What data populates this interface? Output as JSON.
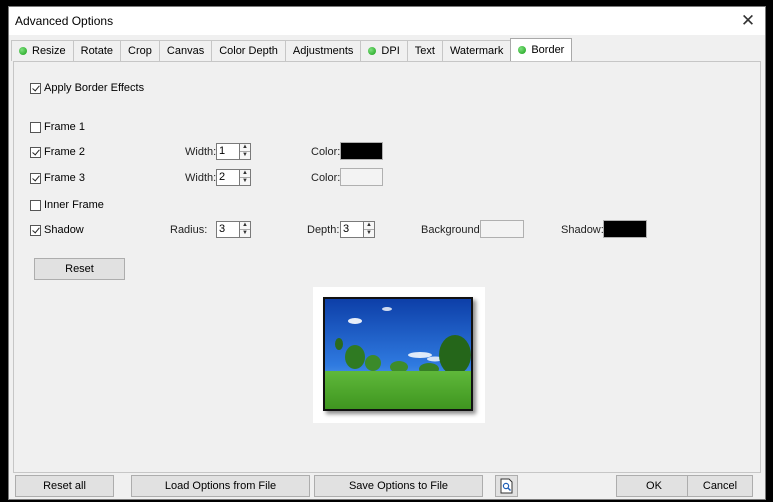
{
  "window": {
    "title": "Advanced Options",
    "close_glyph": "✕"
  },
  "tabs": [
    {
      "label": "Resize",
      "dot": true,
      "active": false
    },
    {
      "label": "Rotate",
      "dot": false,
      "active": false
    },
    {
      "label": "Crop",
      "dot": false,
      "active": false
    },
    {
      "label": "Canvas",
      "dot": false,
      "active": false
    },
    {
      "label": "Color Depth",
      "dot": false,
      "active": false
    },
    {
      "label": "Adjustments",
      "dot": false,
      "active": false
    },
    {
      "label": "DPI",
      "dot": true,
      "active": false
    },
    {
      "label": "Text",
      "dot": false,
      "active": false
    },
    {
      "label": "Watermark",
      "dot": false,
      "active": false
    },
    {
      "label": "Border",
      "dot": true,
      "active": true
    }
  ],
  "border": {
    "apply": {
      "label": "Apply Border Effects",
      "checked": true
    },
    "frame1": {
      "label": "Frame 1",
      "checked": false
    },
    "frame2": {
      "label": "Frame 2",
      "checked": true,
      "width_label": "Width:",
      "width": "1",
      "color_label": "Color:",
      "color": "#000000"
    },
    "frame3": {
      "label": "Frame 3",
      "checked": true,
      "width_label": "Width:",
      "width": "2",
      "color_label": "Color:",
      "color": "#f3f3f3"
    },
    "inner": {
      "label": "Inner Frame",
      "checked": false
    },
    "shadow": {
      "label": "Shadow",
      "checked": true,
      "radius_label": "Radius:",
      "radius": "3",
      "depth_label": "Depth:",
      "depth": "3",
      "background_label": "Background:",
      "background_color": "#f3f3f3",
      "shadow_label": "Shadow:",
      "shadow_color": "#000000"
    },
    "reset_label": "Reset"
  },
  "footer": {
    "reset_all": "Reset all",
    "load": "Load Options from File",
    "save": "Save Options to File",
    "preview_icon": "preview-document-icon",
    "ok": "OK",
    "cancel": "Cancel"
  },
  "colors": {
    "tab_dot": "#18a018",
    "window_bg": "#f0f0f0",
    "sky": "#1e5fd0",
    "grass": "#4fae2a"
  }
}
